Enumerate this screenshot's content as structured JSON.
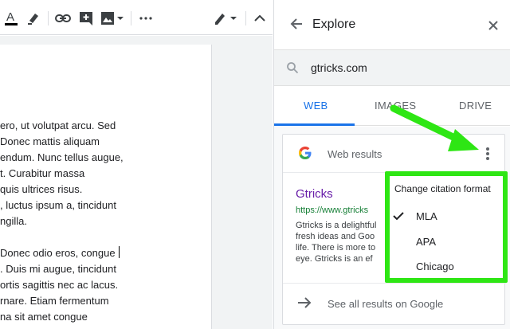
{
  "toolbar": {
    "icons": [
      "text-color-icon",
      "highlight-icon",
      "link-icon",
      "add-comment-icon",
      "image-icon",
      "more-icon",
      "edit-mode-icon",
      "collapse-icon"
    ]
  },
  "document": {
    "lines": [
      "ero, ut volutpat arcu. Sed",
      "Donec mattis aliquam",
      "endum. Nunc tellus augue,",
      "t. Curabitur massa",
      "quis ultrices risus.",
      ", luctus ipsum a, tincidunt",
      "ngilla."
    ],
    "lines2": [
      "Donec odio eros, congue",
      ". Duis mi augue, tincidunt",
      "ortis sagittis nec ac lacus.",
      "rnare. Etiam fermentum",
      "na sit amet congue"
    ]
  },
  "explore": {
    "title": "Explore",
    "search": {
      "value": "gtricks.com"
    },
    "tabs": [
      {
        "label": "WEB",
        "active": true
      },
      {
        "label": "IMAGES",
        "active": false
      },
      {
        "label": "DRIVE",
        "active": false
      }
    ],
    "card": {
      "logo": "G",
      "title": "Web results",
      "result": {
        "title": "Gtricks",
        "url": "https://www.gtricks",
        "snippet": [
          "Gtricks is a delightful",
          "fresh ideas and Goo",
          "life. There is more to",
          "eye. Gtricks is an ef"
        ]
      },
      "see_all": "See all results on Google"
    }
  },
  "menu": {
    "title": "Change citation format",
    "items": [
      {
        "label": "MLA",
        "checked": true
      },
      {
        "label": "APA",
        "checked": false
      },
      {
        "label": "Chicago",
        "checked": false
      }
    ]
  },
  "colors": {
    "accent": "#1a73e8",
    "highlight": "#2ee614",
    "visited_link": "#681da8",
    "url_green": "#188038"
  }
}
